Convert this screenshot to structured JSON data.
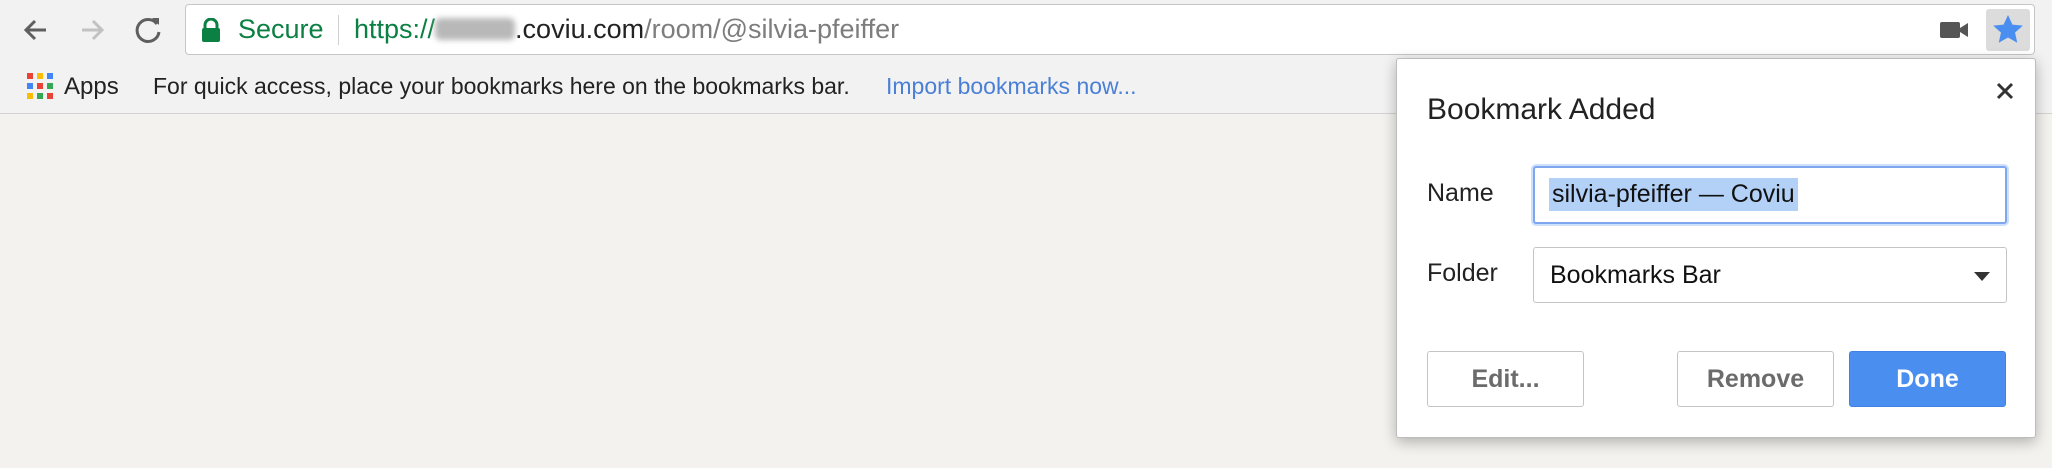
{
  "omnibox": {
    "secure_label": "Secure",
    "url_scheme": "https://",
    "url_host_tail": ".coviu.com",
    "url_path": "/room/@silvia-pfeiffer",
    "secure_color": "#0b8043"
  },
  "toolbar": {
    "icons": [
      "back-arrow-icon",
      "forward-arrow-icon",
      "reload-icon",
      "lock-icon",
      "video-camera-icon",
      "star-icon"
    ]
  },
  "bookmarks_bar": {
    "apps_label": "Apps",
    "hint": "For quick access, place your bookmarks here on the bookmarks bar.",
    "import_link": "Import bookmarks now..."
  },
  "bookmark_bubble": {
    "title": "Bookmark Added",
    "name_label": "Name",
    "name_value": "silvia-pfeiffer — Coviu",
    "folder_label": "Folder",
    "folder_value": "Bookmarks Bar",
    "edit_label": "Edit...",
    "remove_label": "Remove",
    "done_label": "Done",
    "accent_color": "#4a8ef0"
  }
}
